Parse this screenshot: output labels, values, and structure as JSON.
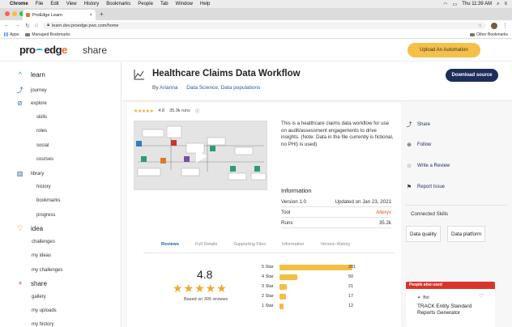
{
  "os_menu": {
    "items": [
      "Chrome",
      "File",
      "Edit",
      "View",
      "History",
      "Bookmarks",
      "People",
      "Tab",
      "Window",
      "Help"
    ],
    "clock": "Thu 11:39 AM"
  },
  "browser": {
    "tab_title": "ProEdge Learn",
    "url": "learn.dev.proedge.pwc.com/home",
    "bookmarks": {
      "apps": "Apps",
      "managed": "Managed Bookmarks",
      "other": "Other Bookmarks"
    }
  },
  "header": {
    "logo_pro": "pro",
    "logo_edg": "edg",
    "section": "share",
    "upload_label": "Upload An Automation"
  },
  "sidebar": {
    "learn": "learn",
    "journey": "journey",
    "explore": "explore",
    "explore_items": [
      "skills",
      "roles",
      "social",
      "courses"
    ],
    "library": "library",
    "library_items": [
      "history",
      "bookmarks",
      "progress"
    ],
    "idea": "idea",
    "idea_items": [
      "challenges",
      "my ideas",
      "my challenges"
    ],
    "share": "share",
    "share_items": [
      "gallery",
      "my uploads",
      "my history"
    ]
  },
  "page": {
    "title": "Healthcare Claims Data Workflow",
    "by": "By",
    "author": "Arianna",
    "tags": "Data Science, Data populations",
    "download_label": "Download source",
    "rating_small": "4.8",
    "runs_label": "35.3k runs",
    "description": "This is a healthcare claims data workflow for use on audit/assessment engagements to drive insights. (Note: Data in the file currently is fictional, no PHI) is used)",
    "info_title": "Information",
    "version": "Version 1.0",
    "updated": "Updated on Jan 23, 2021",
    "tool_label": "Tool",
    "tool_value": "Alteryx",
    "runs_row_label": "Runs",
    "runs_row_value": "35.2k"
  },
  "tabs": [
    "Reviews",
    "Full Details",
    "Supporting Files",
    "Information",
    "Version History"
  ],
  "reviews": {
    "average": "4.8",
    "stars": 5,
    "based_on": "Based on 305 reviews",
    "distribution": [
      {
        "label": "5 Star",
        "count": 201
      },
      {
        "label": "4 Star",
        "count": 50
      },
      {
        "label": "3 Star",
        "count": 21
      },
      {
        "label": "2 Star",
        "count": 17
      },
      {
        "label": "1 Star",
        "count": 12
      }
    ]
  },
  "actions": {
    "share": "Share",
    "follow": "Follow",
    "write_review": "Write a Review",
    "report": "Report Issue"
  },
  "connected_skills": {
    "title": "Connected Skills",
    "chips": [
      "Data quality",
      "Data platform"
    ]
  },
  "also_used": {
    "label": "People also used",
    "kind": "Bot",
    "title": "TRACK Entity Standard Reports Generator"
  },
  "colors": {
    "accent_yellow": "#f4c04a",
    "navy": "#1d2d5c",
    "star": "#f0a823",
    "link_blue": "#1f5fa6",
    "alteryx_orange": "#d85a1e"
  }
}
